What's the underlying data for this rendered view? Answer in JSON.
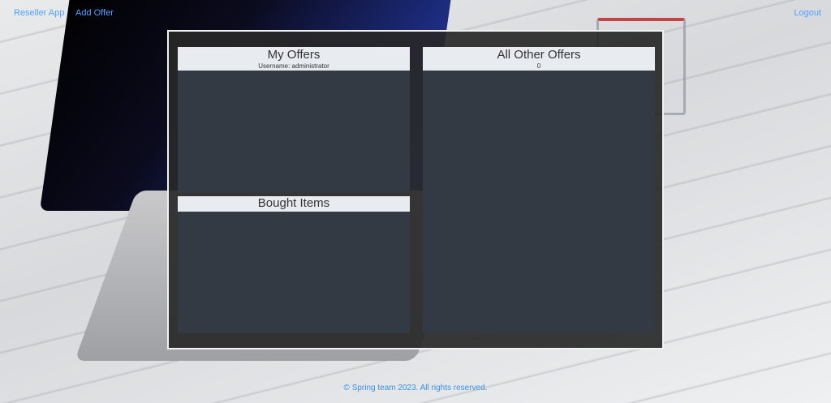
{
  "nav": {
    "brand": "Reseller App",
    "add_offer": "Add Offer",
    "logout": "Logout"
  },
  "my_offers": {
    "title": "My Offers",
    "username_line": "Username: administrator"
  },
  "bought_items": {
    "title": "Bought Items"
  },
  "other_offers": {
    "title": "All Other Offers",
    "count": "0"
  },
  "footer": {
    "text": "© Spring team 2023. All rights reserved."
  },
  "colors": {
    "link": "#4ea3ff",
    "card_header": "#e8ebef",
    "card_body": "#343a44",
    "panel": "#282828"
  }
}
